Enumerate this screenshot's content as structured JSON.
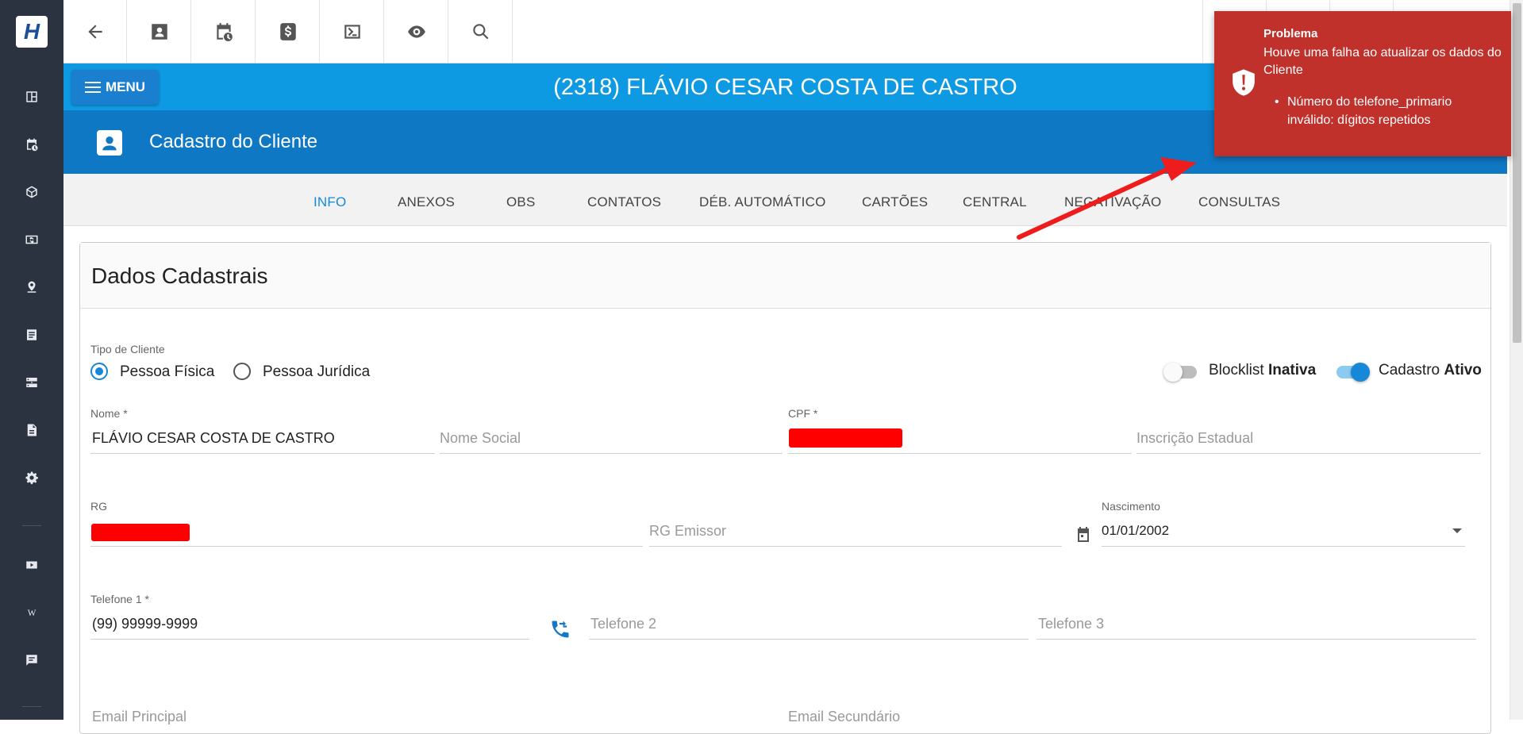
{
  "app": {
    "logo_glyph": "H"
  },
  "sidebar": {
    "icons": [
      "dashboard-icon",
      "calendar-clock-icon",
      "box-icon",
      "money-icon",
      "location-icon",
      "list-icon",
      "server-icon",
      "document-icon",
      "gear-icon",
      "youtube-icon",
      "wiki-icon",
      "chat-icon"
    ]
  },
  "header": {
    "menu_label": "MENU",
    "client_title": "(2318) FLÁVIO CESAR COSTA DE CASTRO",
    "subtitle": "Cadastro do Cliente"
  },
  "tabs": [
    "INFO",
    "ANEXOS",
    "OBS",
    "CONTATOS",
    "DÉB. AUTOMÁTICO",
    "CARTÕES",
    "CENTRAL",
    "NEGATIVAÇÃO",
    "CONSULTAS"
  ],
  "active_tab": "INFO",
  "form": {
    "section_title": "Dados Cadastrais",
    "tipo_label": "Tipo de Cliente",
    "tipo_options": [
      "Pessoa Física",
      "Pessoa Jurídica"
    ],
    "tipo_selected": "Pessoa Física",
    "blocklist_label": "Blocklist",
    "blocklist_state": "Inativa",
    "cadastro_label": "Cadastro",
    "cadastro_state": "Ativo",
    "nome_label": "Nome *",
    "nome_value": "FLÁVIO CESAR COSTA DE CASTRO",
    "nome_social_placeholder": "Nome Social",
    "cpf_label": "CPF *",
    "inscricao_placeholder": "Inscrição Estadual",
    "rg_label": "RG",
    "rg_emissor_placeholder": "RG Emissor",
    "nascimento_label": "Nascimento",
    "nascimento_value": "01/01/2002",
    "telefone1_label": "Telefone 1 *",
    "telefone1_value": "(99) 99999-9999",
    "telefone2_placeholder": "Telefone 2",
    "telefone3_placeholder": "Telefone 3",
    "email_principal_placeholder": "Email Principal",
    "email_secundario_placeholder": "Email Secundário"
  },
  "toast": {
    "title": "Problema",
    "message": "Houve uma falha ao atualizar os dados do Cliente",
    "items": [
      "Número do telefone_primario inválido: dígitos repetidos"
    ]
  },
  "colors": {
    "sidebar": "#2b3240",
    "header_blue": "#0e9ae2",
    "subheader_blue": "#0f78c4",
    "accent": "#1788d8",
    "toast_red": "#c1312c",
    "annotation_arrow": "#ee1c1c"
  }
}
